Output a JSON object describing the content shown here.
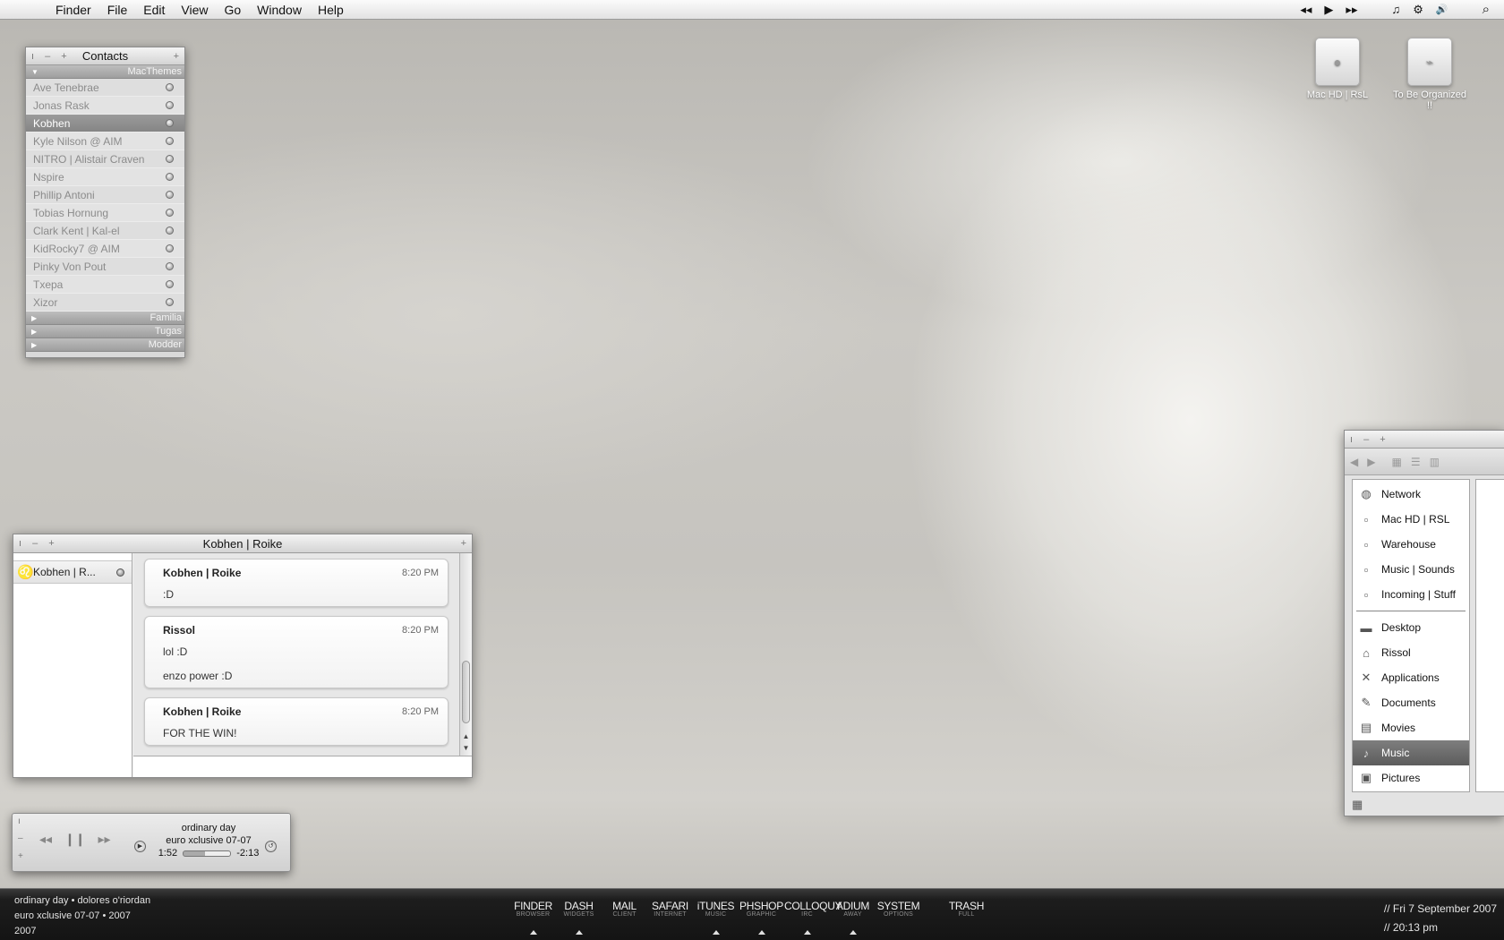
{
  "menubar": {
    "apple": "",
    "items": [
      "Finder",
      "File",
      "Edit",
      "View",
      "Go",
      "Window",
      "Help"
    ],
    "extras": {
      "prev": "◂◂",
      "play": "▶",
      "next": "▸▸",
      "music_icon": "♫",
      "gear_icon": "⚙",
      "volume_icon": "🔊",
      "spotlight_icon": "⌕"
    }
  },
  "desktop": {
    "drives": [
      {
        "name": "Mac HD | RsL",
        "icon": "apple-drive-icon"
      },
      {
        "name": "To Be Organized !!",
        "icon": "firewire-drive-icon"
      }
    ]
  },
  "contacts": {
    "title": "Contacts",
    "groups": {
      "open": "MacThemes",
      "collapsed": [
        "Familia",
        "Tugas",
        "Modder"
      ]
    },
    "members": [
      {
        "name": "Ave Tenebrae"
      },
      {
        "name": "Jonas Rask"
      },
      {
        "name": "Kobhen",
        "selected": true
      },
      {
        "name": "Kyle Nilson @ AIM"
      },
      {
        "name": "NITRO | Alistair Craven"
      },
      {
        "name": "Nspire"
      },
      {
        "name": "Phillip Antoni"
      },
      {
        "name": "Tobias Hornung"
      },
      {
        "name": "Clark Kent | Kal-el"
      },
      {
        "name": "KidRocky7 @ AIM"
      },
      {
        "name": "Pinky Von Pout"
      },
      {
        "name": "Txepa"
      },
      {
        "name": "Xizor"
      }
    ]
  },
  "chat": {
    "title": "Kobhen | Roike",
    "tab_label": "Kobhen | R...",
    "messages": [
      {
        "sender": "Kobhen | Roike",
        "time": "8:20 PM",
        "lines": [
          ":D"
        ]
      },
      {
        "sender": "Rissol",
        "time": "8:20 PM",
        "lines": [
          "lol :D",
          "enzo power :D"
        ]
      },
      {
        "sender": "Kobhen | Roike",
        "time": "8:20 PM",
        "lines": [
          "FOR THE WIN!"
        ]
      }
    ]
  },
  "player": {
    "track": "ordinary day",
    "album": "euro xclusive 07-07",
    "elapsed": "1:52",
    "remaining": "-2:13",
    "progress": 0.46
  },
  "finder": {
    "sidebar_devices": [
      {
        "label": "Network",
        "icon": "globe-icon"
      },
      {
        "label": "Mac HD | RSL",
        "icon": "disk-icon"
      },
      {
        "label": "Warehouse",
        "icon": "disk-icon"
      },
      {
        "label": "Music | Sounds",
        "icon": "disk-icon"
      },
      {
        "label": "Incoming | Stuff",
        "icon": "disk-icon"
      }
    ],
    "sidebar_places": [
      {
        "label": "Desktop",
        "icon": "desktop-folder-icon"
      },
      {
        "label": "Rissol",
        "icon": "home-icon"
      },
      {
        "label": "Applications",
        "icon": "applications-icon"
      },
      {
        "label": "Documents",
        "icon": "documents-icon"
      },
      {
        "label": "Movies",
        "icon": "film-icon"
      },
      {
        "label": "Music",
        "icon": "music-note-icon",
        "selected": true
      },
      {
        "label": "Pictures",
        "icon": "pictures-icon"
      }
    ]
  },
  "statusbar": {
    "now_playing": [
      "ordinary day • dolores o'riordan",
      "euro xclusive 07-07 • 2007",
      "2007"
    ],
    "date": "// Fri 7  September 2007",
    "time": "// 20:13 pm"
  },
  "dock": {
    "items": [
      {
        "label": "FINDER",
        "sub": "BROWSER",
        "running": true
      },
      {
        "label": "DASH",
        "sub": "WIDGETS",
        "running": true
      },
      {
        "label": "MAIL",
        "sub": "CLIENT",
        "running": false
      },
      {
        "label": "SAFARI",
        "sub": "INTERNET",
        "running": false
      },
      {
        "label": "iTUNES",
        "sub": "MUSIC",
        "running": true
      },
      {
        "label": "PHSHOP",
        "sub": "GRAPHIC",
        "running": true
      },
      {
        "label": "COLLOQUY",
        "sub": "IRC",
        "running": true
      },
      {
        "label": "ADIUM",
        "sub": "AWAY",
        "running": true
      },
      {
        "label": "SYSTEM",
        "sub": "OPTIONS",
        "running": false
      }
    ],
    "trash": {
      "label": "TRASH",
      "sub": "FULL"
    }
  }
}
